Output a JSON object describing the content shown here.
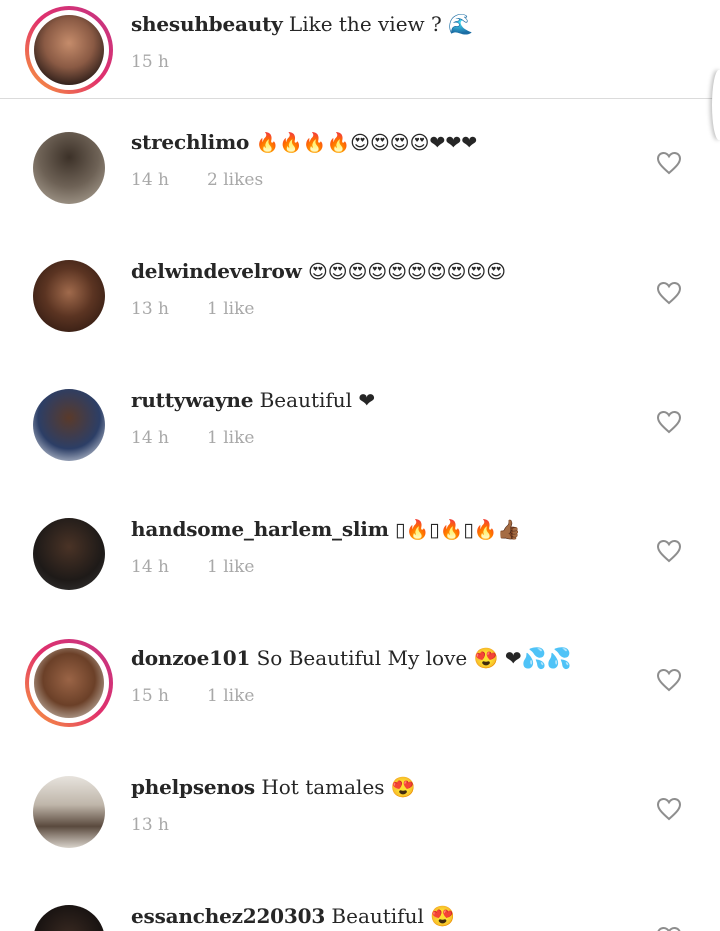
{
  "caption": {
    "username": "shesuhbeauty",
    "text": "Like the view ? 🌊",
    "time": "15 h"
  },
  "comments": [
    {
      "username": "strechlimo",
      "text": "🔥🔥🔥🔥😍😍😍😍❤❤❤",
      "time": "14 h",
      "likes": "2 likes"
    },
    {
      "username": "delwindevelrow",
      "text": "😍😍😍😍😍😍😍😍😍😍",
      "time": "13 h",
      "likes": "1 like"
    },
    {
      "username": "ruttywayne",
      "text": "Beautiful ❤",
      "time": "14 h",
      "likes": "1 like"
    },
    {
      "username": "handsome_harlem_slim",
      "text": "▯🔥▯🔥▯🔥👍🏾",
      "time": "14 h",
      "likes": "1 like"
    },
    {
      "username": "donzoe101",
      "text": "So Beautiful My love 😍 ❤💦💦",
      "time": "15 h",
      "likes": "1 like"
    },
    {
      "username": "phelpsenos",
      "text": "Hot tamales 😍",
      "time": "13 h",
      "likes": ""
    },
    {
      "username": "essanchez220303",
      "text": "Beautiful 😍",
      "time": "",
      "likes": ""
    }
  ],
  "colors": {
    "meta": "#a8a8a8",
    "divider": "#dbdbdb",
    "story_ring": "#e1306c"
  },
  "icons": {
    "like": "heart-outline-icon"
  }
}
